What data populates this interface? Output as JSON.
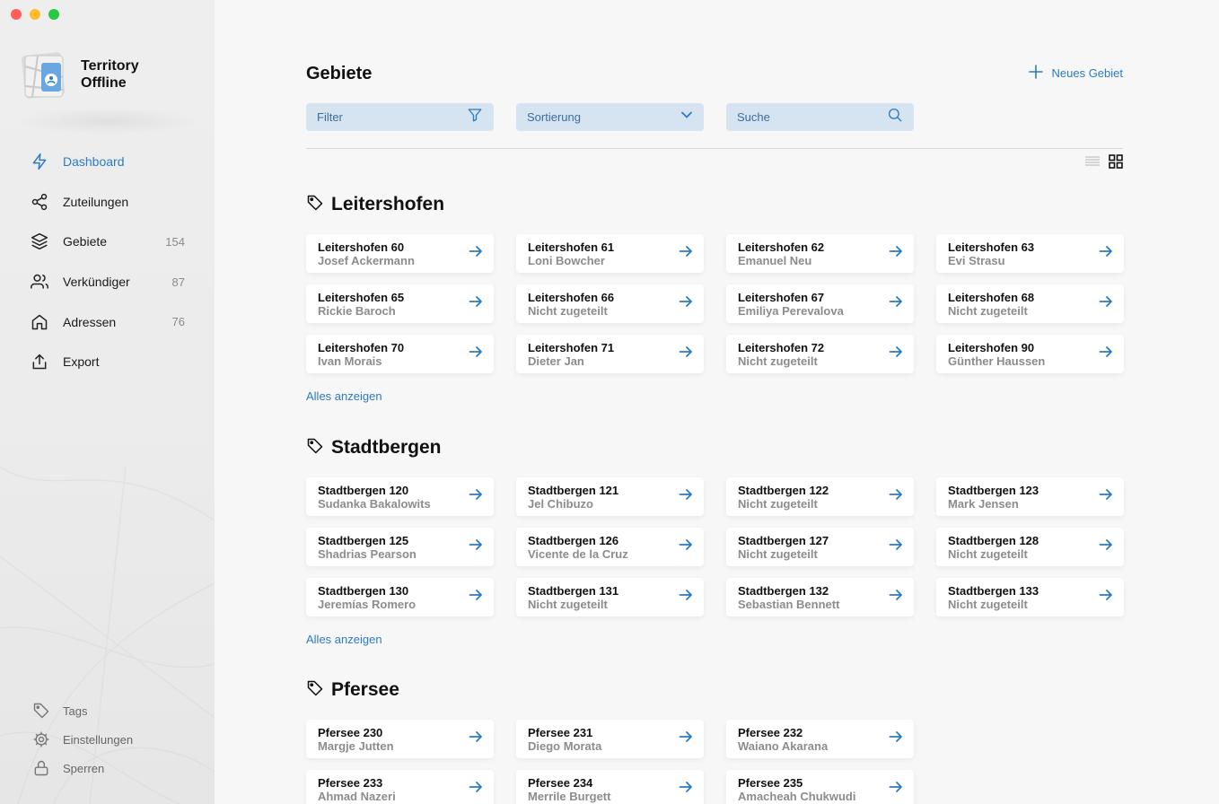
{
  "app": {
    "name_line1": "Territory",
    "name_line2": "Offline"
  },
  "sidebar": {
    "items": [
      {
        "label": "Dashboard",
        "count": "",
        "icon": "bolt-icon",
        "active": true
      },
      {
        "label": "Zuteilungen",
        "count": "",
        "icon": "share-icon"
      },
      {
        "label": "Gebiete",
        "count": "154",
        "icon": "layers-icon"
      },
      {
        "label": "Verkündiger",
        "count": "87",
        "icon": "users-icon"
      },
      {
        "label": "Adressen",
        "count": "76",
        "icon": "home-icon"
      },
      {
        "label": "Export",
        "count": "",
        "icon": "upload-icon"
      }
    ],
    "bottom": [
      {
        "label": "Tags",
        "icon": "tag-icon"
      },
      {
        "label": "Einstellungen",
        "icon": "gear-icon"
      },
      {
        "label": "Sperren",
        "icon": "lock-icon"
      }
    ]
  },
  "header": {
    "title": "Gebiete",
    "new_label": "Neues Gebiet"
  },
  "controls": {
    "filter": "Filter",
    "sort": "Sortierung",
    "search": "Suche"
  },
  "colors": {
    "accent": "#2b7bc4",
    "control_bg": "#d6e4f2"
  },
  "sections": [
    {
      "title": "Leitershofen",
      "show_all": "Alles anzeigen",
      "cards": [
        {
          "name": "Leitershofen 60",
          "assignee": "Josef Ackermann"
        },
        {
          "name": "Leitershofen 61",
          "assignee": "Loni Bowcher"
        },
        {
          "name": "Leitershofen 62",
          "assignee": "Emanuel Neu"
        },
        {
          "name": "Leitershofen 63",
          "assignee": "Evi Strasu"
        },
        {
          "name": "Leitershofen 65",
          "assignee": "Rickie Baroch"
        },
        {
          "name": "Leitershofen 66",
          "assignee": "Nicht zugeteilt"
        },
        {
          "name": "Leitershofen 67",
          "assignee": "Emiliya Perevalova"
        },
        {
          "name": "Leitershofen 68",
          "assignee": "Nicht zugeteilt"
        },
        {
          "name": "Leitershofen 70",
          "assignee": "Ivan Morais"
        },
        {
          "name": "Leitershofen 71",
          "assignee": "Dieter Jan"
        },
        {
          "name": "Leitershofen 72",
          "assignee": "Nicht zugeteilt"
        },
        {
          "name": "Leitershofen 90",
          "assignee": "Günther Haussen"
        }
      ]
    },
    {
      "title": "Stadtbergen",
      "show_all": "Alles anzeigen",
      "cards": [
        {
          "name": "Stadtbergen 120",
          "assignee": "Sudanka Bakalowits"
        },
        {
          "name": "Stadtbergen 121",
          "assignee": "Jel Chibuzo"
        },
        {
          "name": "Stadtbergen 122",
          "assignee": "Nicht zugeteilt"
        },
        {
          "name": "Stadtbergen 123",
          "assignee": "Mark Jensen"
        },
        {
          "name": "Stadtbergen 125",
          "assignee": "Shadrias Pearson"
        },
        {
          "name": "Stadtbergen 126",
          "assignee": "Vicente de la Cruz"
        },
        {
          "name": "Stadtbergen 127",
          "assignee": "Nicht zugeteilt"
        },
        {
          "name": "Stadtbergen 128",
          "assignee": "Nicht zugeteilt"
        },
        {
          "name": "Stadtbergen 130",
          "assignee": "Jeremías Romero"
        },
        {
          "name": "Stadtbergen 131",
          "assignee": "Nicht zugeteilt"
        },
        {
          "name": "Stadtbergen 132",
          "assignee": "Sebastian Bennett"
        },
        {
          "name": "Stadtbergen 133",
          "assignee": "Nicht zugeteilt"
        }
      ]
    },
    {
      "title": "Pfersee",
      "show_all": "",
      "cards": [
        {
          "name": "Pfersee 230",
          "assignee": "Margje Jutten"
        },
        {
          "name": "Pfersee 231",
          "assignee": "Diego Morata"
        },
        {
          "name": "Pfersee 232",
          "assignee": "Waiano Akarana"
        },
        {
          "name": "",
          "assignee": ""
        },
        {
          "name": "Pfersee 233",
          "assignee": "Ahmad Nazeri"
        },
        {
          "name": "Pfersee 234",
          "assignee": "Merrile Burgett"
        },
        {
          "name": "Pfersee 235",
          "assignee": "Amacheah Chukwudi"
        }
      ]
    }
  ]
}
